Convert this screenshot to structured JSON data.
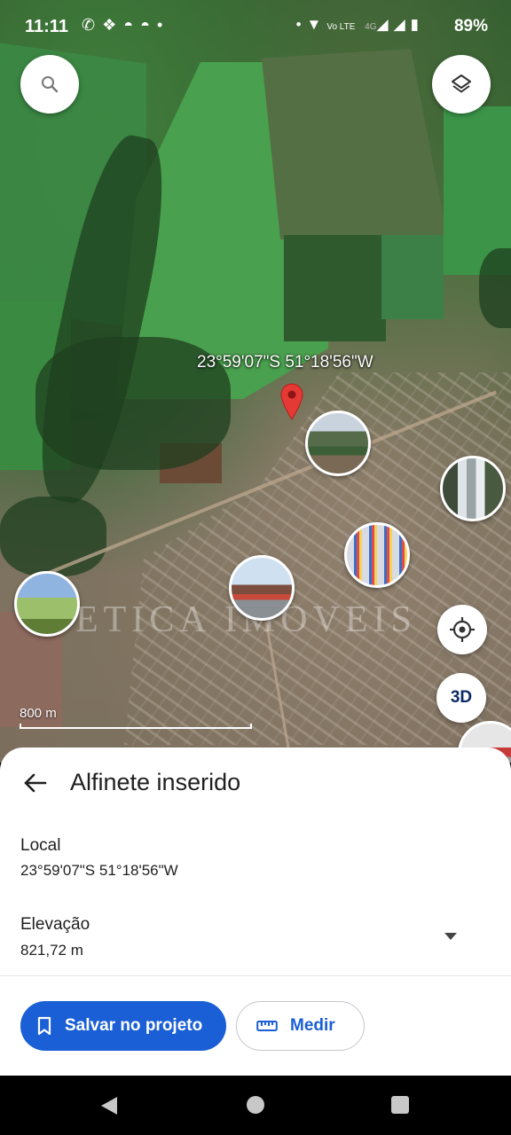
{
  "status_bar": {
    "time": "11:11",
    "notification_icons": [
      "whatsapp-icon",
      "dropbox-icon",
      "app-icon",
      "app-icon",
      "dot-icon"
    ],
    "network_text_volte": "Vo LTE",
    "network_text_4g": "4G",
    "battery_percent": "89%"
  },
  "map": {
    "coordinate_label": "23°59'07\"S 51°18'56\"W",
    "scale_label": "800 m",
    "watermark_text": "ETICA IMOVEIS",
    "button_3d_label": "3D",
    "pin_color": "#e53935"
  },
  "sheet": {
    "title": "Alfinete inserido",
    "local_label": "Local",
    "local_value": "23°59'07\"S 51°18'56\"W",
    "elevation_label": "Elevação",
    "elevation_value": "821,72 m",
    "save_button_label": "Salvar no projeto",
    "measure_button_label": "Medir",
    "accent_color": "#1a5fd6"
  }
}
